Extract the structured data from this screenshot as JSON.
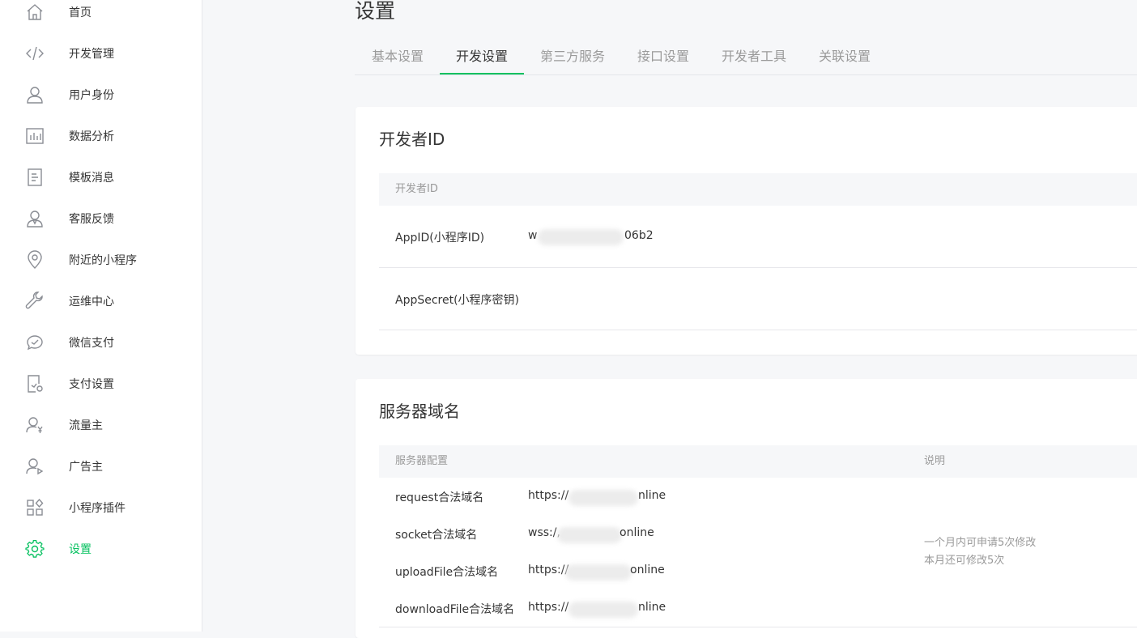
{
  "sidebar": {
    "items": [
      {
        "label": "首页",
        "icon": "home-icon"
      },
      {
        "label": "开发管理",
        "icon": "code-icon"
      },
      {
        "label": "用户身份",
        "icon": "user-icon"
      },
      {
        "label": "数据分析",
        "icon": "bar-chart-icon"
      },
      {
        "label": "模板消息",
        "icon": "document-icon"
      },
      {
        "label": "客服反馈",
        "icon": "support-user-icon"
      },
      {
        "label": "附近的小程序",
        "icon": "location-pin-icon"
      },
      {
        "label": "运维中心",
        "icon": "wrench-icon"
      },
      {
        "label": "微信支付",
        "icon": "wechat-pay-icon"
      },
      {
        "label": "支付设置",
        "icon": "payment-settings-icon"
      },
      {
        "label": "流量主",
        "icon": "user-yen-icon"
      },
      {
        "label": "广告主",
        "icon": "user-ad-icon"
      },
      {
        "label": "小程序插件",
        "icon": "plugin-grid-icon"
      },
      {
        "label": "设置",
        "icon": "gear-icon",
        "active": true
      }
    ]
  },
  "page": {
    "title": "设置"
  },
  "tabs": [
    "基本设置",
    "开发设置",
    "第三方服务",
    "接口设置",
    "开发者工具",
    "关联设置"
  ],
  "active_tab": "开发设置",
  "developer_id": {
    "title": "开发者ID",
    "table_header": "开发者ID",
    "rows": [
      {
        "label": "AppID(小程序ID)",
        "value_prefix": "w",
        "value_suffix": "06b2"
      },
      {
        "label": "AppSecret(小程序密钥)"
      }
    ]
  },
  "server_domain": {
    "title": "服务器域名",
    "header_config": "服务器配置",
    "header_note": "说明",
    "rows": [
      {
        "label": "request合法域名",
        "value_prefix": "https://",
        "value_suffix": "nline"
      },
      {
        "label": "socket合法域名",
        "value_prefix": "wss:/,",
        "value_suffix": "online"
      },
      {
        "label": "uploadFile合法域名",
        "value_prefix": "https://",
        "value_suffix": "online"
      },
      {
        "label": "downloadFile合法域名",
        "value_prefix": "https://",
        "value_suffix": "nline"
      }
    ],
    "note_line1": "一个月内可申请5次修改",
    "note_line2": "本月还可修改5次"
  },
  "colors": {
    "accent": "#07c160",
    "text": "#353535",
    "muted": "#9a9a9a",
    "bg": "#f6f7f9"
  }
}
